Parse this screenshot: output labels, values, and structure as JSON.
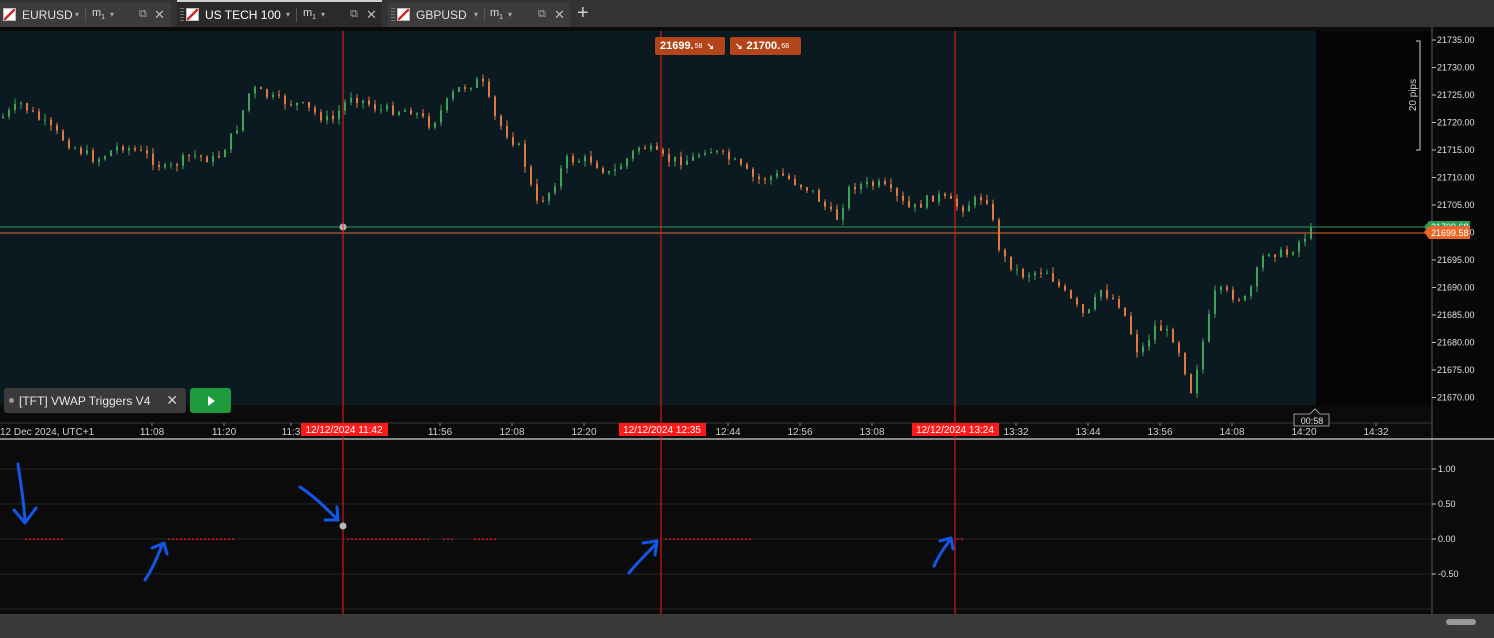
{
  "tabs": [
    {
      "symbol": "EURUSD",
      "timeframe": "m",
      "timeframe_sub": "1",
      "active": false
    },
    {
      "symbol": "US TECH 100",
      "timeframe": "m",
      "timeframe_sub": "1",
      "active": true
    },
    {
      "symbol": "GBPUSD",
      "timeframe": "m",
      "timeframe_sub": "1",
      "active": false
    }
  ],
  "icons": {
    "flag": "instrument-flag-icon",
    "dropdown": "chevron-down-icon",
    "popout": "popout-icon",
    "close": "close-icon",
    "add_tab": "plus-icon",
    "play": "play-icon",
    "arrow": "hand-drawn-arrow-icon"
  },
  "labels": {
    "dropdown": "▾",
    "popout": "⧉",
    "close": "✕",
    "add_tab": "+"
  },
  "price_tags": {
    "sell_main": "21699.",
    "sell_small": "58",
    "buy_main": "21700.",
    "buy_small": "68",
    "sell_arrow": "↘",
    "buy_arrow": "↘"
  },
  "price_scale_labels": [
    "21735.00",
    "21730.00",
    "21725.00",
    "21720.00",
    "21715.00",
    "21710.00",
    "21705.00",
    "21700.00",
    "21695.00",
    "21690.00",
    "21685.00",
    "21680.00",
    "21675.00",
    "21670.00"
  ],
  "price_scale_overlay": {
    "ask": "21700.68",
    "bid": "21699.58"
  },
  "range_label": "20 pips",
  "time_axis": {
    "start_label": "12 Dec 2024, UTC+1",
    "ticks": [
      "11:08",
      "11:20",
      "11:3",
      "11:56",
      "12:08",
      "12:20",
      "12:44",
      "12:56",
      "13:08",
      "13:32",
      "13:44",
      "13:56",
      "14:08",
      "14:20",
      "14:32"
    ],
    "markers": [
      "12/12/2024 11:42",
      "12/12/2024 12:35",
      "12/12/2024 13:24"
    ],
    "countdown": "00:58"
  },
  "indicator": {
    "name": "[TFT] VWAP Triggers V4",
    "close_label": "✕",
    "scale_labels": [
      "1.00",
      "0.50",
      "0.00",
      "-0.50"
    ]
  },
  "colors": {
    "chart_bg": "#0a1a20",
    "bull": "#3ea356",
    "bear": "#e07a40",
    "marker_red": "#ff1a1a",
    "line_green": "#2e9a5a",
    "line_orange": "#e8682c",
    "arrow_blue": "#1457e6"
  },
  "chart_data": {
    "type": "candlestick",
    "price_range": [
      21668,
      21735
    ],
    "series": [
      {
        "name": "US TECH 100",
        "values": []
      }
    ],
    "oscillator_range": [
      -1.0,
      1.25
    ]
  }
}
